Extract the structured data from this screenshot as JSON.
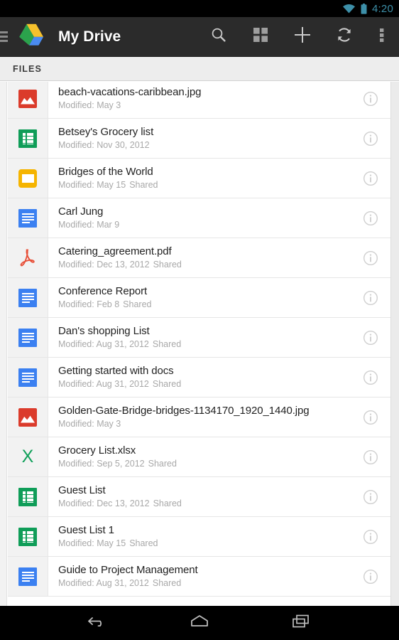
{
  "statusbar": {
    "time": "4:20",
    "wifi_icon": "wifi-icon",
    "battery_icon": "battery-icon",
    "icon_color": "#3d8fa8"
  },
  "actionbar": {
    "drawer_icon": "drawer-handle-icon",
    "logo_icon": "google-drive-logo",
    "title": "My Drive",
    "background": "#2b2b2b",
    "buttons": [
      {
        "name": "search-button",
        "icon": "search-icon"
      },
      {
        "name": "grid-view-button",
        "icon": "grid-view-icon"
      },
      {
        "name": "add-button",
        "icon": "plus-icon"
      },
      {
        "name": "refresh-button",
        "icon": "refresh-icon"
      },
      {
        "name": "overflow-button",
        "icon": "more-vertical-icon"
      }
    ]
  },
  "tabs": [
    {
      "label": "FILES",
      "selected": true
    }
  ],
  "list": {
    "modified_prefix": "Modified:",
    "shared_label": "Shared",
    "info_icon": "info-icon",
    "rows": [
      {
        "name": "beach-vacations-caribbean.jpg",
        "meta": "Modified: May 3",
        "shared": "",
        "icon": "image-file-icon",
        "type": "image"
      },
      {
        "name": "Betsey's Grocery list",
        "meta": "Modified: Nov 30, 2012",
        "shared": "",
        "icon": "spreadsheet-file-icon",
        "type": "sheet"
      },
      {
        "name": "Bridges of the World",
        "meta": "Modified: May 15",
        "shared": "Shared",
        "icon": "folder-icon",
        "type": "folder"
      },
      {
        "name": "Carl Jung",
        "meta": "Modified: Mar 9",
        "shared": "",
        "icon": "document-file-icon",
        "type": "doc"
      },
      {
        "name": "Catering_agreement.pdf",
        "meta": "Modified: Dec 13, 2012",
        "shared": "Shared",
        "icon": "pdf-file-icon",
        "type": "pdf"
      },
      {
        "name": "Conference Report",
        "meta": "Modified: Feb 8",
        "shared": "Shared",
        "icon": "document-file-icon",
        "type": "doc"
      },
      {
        "name": "Dan's shopping List",
        "meta": "Modified: Aug 31, 2012",
        "shared": "Shared",
        "icon": "document-file-icon",
        "type": "doc"
      },
      {
        "name": "Getting started with docs",
        "meta": "Modified: Aug 31, 2012",
        "shared": "Shared",
        "icon": "document-file-icon",
        "type": "doc"
      },
      {
        "name": "Golden-Gate-Bridge-bridges-1134170_1920_1440.jpg",
        "meta": "Modified: May 3",
        "shared": "",
        "icon": "image-file-icon",
        "type": "image"
      },
      {
        "name": "Grocery List.xlsx",
        "meta": "Modified: Sep 5, 2012",
        "shared": "Shared",
        "icon": "excel-file-icon",
        "type": "xls"
      },
      {
        "name": "Guest List",
        "meta": "Modified: Dec 13, 2012",
        "shared": "Shared",
        "icon": "spreadsheet-file-icon",
        "type": "sheet"
      },
      {
        "name": "Guest List 1",
        "meta": "Modified: May 15",
        "shared": "Shared",
        "icon": "spreadsheet-file-icon",
        "type": "sheet"
      },
      {
        "name": "Guide to Project Management",
        "meta": "Modified: Aug 31, 2012",
        "shared": "Shared",
        "icon": "document-file-icon",
        "type": "doc"
      }
    ]
  },
  "navbar": {
    "buttons": [
      {
        "name": "back-button",
        "icon": "back-arrow-icon"
      },
      {
        "name": "home-button",
        "icon": "home-icon"
      },
      {
        "name": "recents-button",
        "icon": "recents-icon"
      }
    ]
  },
  "colors": {
    "image_red": "#db3b2b",
    "sheet_green": "#0f9d58",
    "folder_yellow": "#f5b400",
    "doc_blue": "#3b80f1",
    "pdf_red": "#e8513a",
    "excel_green": "#11a05a"
  }
}
